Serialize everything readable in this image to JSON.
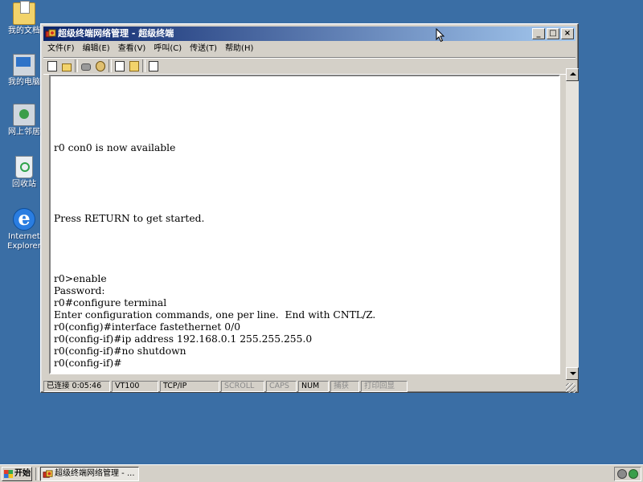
{
  "desktop": {
    "icons": [
      {
        "label": "我的文档",
        "icon": "my-documents-icon"
      },
      {
        "label": "我的电脑",
        "icon": "my-computer-icon"
      },
      {
        "label": "网上邻居",
        "icon": "network-places-icon"
      },
      {
        "label": "回收站",
        "icon": "recycle-bin-icon"
      },
      {
        "label_line1": "Internet",
        "label_line2": "Explorer",
        "icon": "internet-explorer-icon"
      }
    ]
  },
  "window": {
    "title": "超级终端网络管理 - 超级终端",
    "title_buttons": {
      "minimize": "_",
      "maximize": "□",
      "close": "×"
    },
    "menu": [
      "文件(F)",
      "编辑(E)",
      "查看(V)",
      "呼叫(C)",
      "传送(T)",
      "帮助(H)"
    ],
    "toolbar": [
      "new-document-icon",
      "open-folder-icon",
      "phone-icon",
      "hang-up-icon",
      "copy-icon",
      "paste-icon",
      "properties-icon"
    ],
    "terminal_lines": [
      "r0 con0 is now available",
      "Press RETURN to get started.",
      "r0>enable",
      "Password:",
      "r0#configure terminal",
      "Enter configuration commands, one per line.  End with CNTL/Z.",
      "r0(config)#interface fastethernet 0/0",
      "r0(config-if)#ip address 192.168.0.1 255.255.255.0",
      "r0(config-if)#no shutdown",
      "r0(config-if)#"
    ],
    "status": {
      "connection": "已连接 0:05:46",
      "emulation": "VT100",
      "protocol": "TCP/IP",
      "scroll": "SCROLL",
      "caps": "CAPS",
      "num": "NUM",
      "capture": "捕获",
      "print_echo": "打印回显"
    }
  },
  "taskbar": {
    "start_label": "开始",
    "task_title": "超级终端网络管理 - ..."
  }
}
